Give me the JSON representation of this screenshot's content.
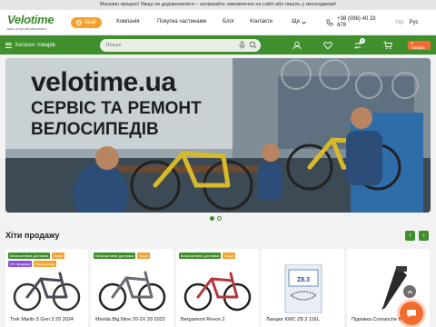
{
  "notice": "Магазин працює! Якщо не додзвонилися – залишайте замовлення на сайті або пишіть у месенджери!",
  "header": {
    "logo_main": "Velotime",
    "logo_sub": "ваш супутник велосвіту",
    "promo_label": "Акції",
    "nav": [
      "Компанія",
      "Покупка частинами",
      "Блог",
      "Контакти",
      "Ще"
    ],
    "phone": "+38 (096) 40 33 678",
    "lang_ukr": "Укр",
    "lang_rus": "Рус"
  },
  "bar": {
    "catalog_label": "Каталог товарів",
    "search_placeholder": "Пошук",
    "wishlist_count": "0",
    "cart_label": "0 товарів",
    "icons": [
      "microphone-icon",
      "search-icon",
      "user-icon",
      "heart-icon",
      "compare-icon",
      "cart-icon"
    ]
  },
  "banner": {
    "title": "velotime.ua",
    "subtitle": "СЕРВІС ТА РЕМОНТ ВЕЛОСИПЕДІВ",
    "slides_total": 2,
    "slide_active": 1
  },
  "hits": {
    "title": "Хіти продажу",
    "cards": [
      {
        "name": "Trek Marlin 5 Gen 3 29 2024",
        "tags": [
          [
            "Безкоштовна доставка",
            "g"
          ],
          [
            "Акція",
            "o"
          ],
          [
            "Хіт продажу",
            "p"
          ],
          [
            "Відеоогляд",
            "o"
          ]
        ]
      },
      {
        "name": "Merida Big.Nine 20-2X 29 2023",
        "tags": [
          [
            "Безкоштовна доставка",
            "g"
          ],
          [
            "Акція",
            "o"
          ]
        ]
      },
      {
        "name": "Bergamont Revox 2",
        "tags": [
          [
            "Безкоштовна доставка",
            "g"
          ],
          [
            "Акція",
            "o"
          ]
        ]
      },
      {
        "name": "Ланцюг KMC Z8.3 116L",
        "tags": []
      },
      {
        "name": "Підніжка Comanche BRIDGE",
        "tags": []
      }
    ]
  },
  "colors": {
    "brand_green": "#3f8f2d",
    "accent_orange": "#f3a12f",
    "cart_orange": "#f36b2d"
  }
}
